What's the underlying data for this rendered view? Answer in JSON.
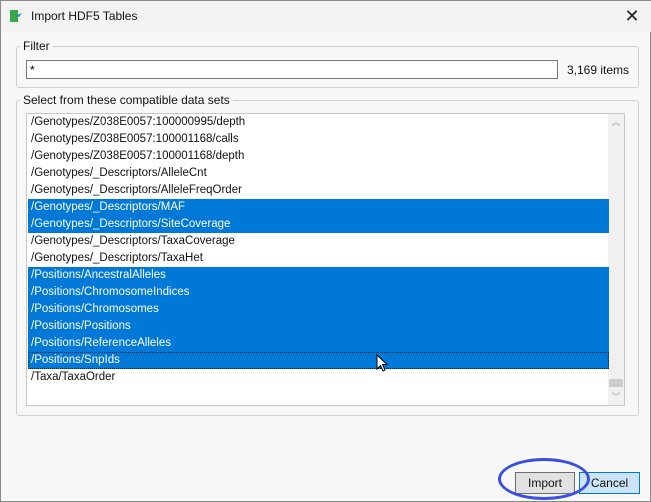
{
  "window": {
    "title": "Import HDF5 Tables",
    "close_label": "✕"
  },
  "filter": {
    "legend": "Filter",
    "value": "*",
    "count": "3,169 items"
  },
  "datasets": {
    "legend": "Select from these compatible data sets",
    "items": [
      {
        "label": "/Genotypes/Z038E0057:100000995/depth",
        "selected": false
      },
      {
        "label": "/Genotypes/Z038E0057:100001168/calls",
        "selected": false
      },
      {
        "label": "/Genotypes/Z038E0057:100001168/depth",
        "selected": false
      },
      {
        "label": "/Genotypes/_Descriptors/AlleleCnt",
        "selected": false
      },
      {
        "label": "/Genotypes/_Descriptors/AlleleFreqOrder",
        "selected": false
      },
      {
        "label": "/Genotypes/_Descriptors/MAF",
        "selected": true
      },
      {
        "label": "/Genotypes/_Descriptors/SiteCoverage",
        "selected": true
      },
      {
        "label": "/Genotypes/_Descriptors/TaxaCoverage",
        "selected": false
      },
      {
        "label": "/Genotypes/_Descriptors/TaxaHet",
        "selected": false
      },
      {
        "label": "/Positions/AncestralAlleles",
        "selected": true
      },
      {
        "label": "/Positions/ChromosomeIndices",
        "selected": true
      },
      {
        "label": "/Positions/Chromosomes",
        "selected": true
      },
      {
        "label": "/Positions/Positions",
        "selected": true
      },
      {
        "label": "/Positions/ReferenceAlleles",
        "selected": true
      },
      {
        "label": "/Positions/SnpIds",
        "selected": true,
        "focused": true
      },
      {
        "label": "/Taxa/TaxaOrder",
        "selected": false
      }
    ]
  },
  "buttons": {
    "import": "Import",
    "cancel": "Cancel"
  },
  "colors": {
    "selection": "#0078d7",
    "annotation_ring": "#3b4fe0"
  }
}
